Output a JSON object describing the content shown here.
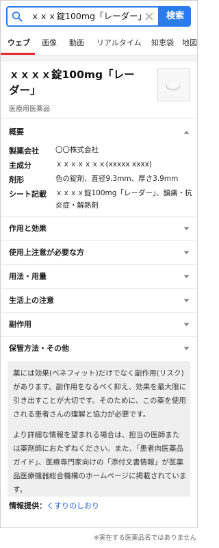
{
  "search": {
    "query": "ｘｘｘ錠100mg「レーダー」",
    "button_label": "検索"
  },
  "tabs": [
    {
      "label": "ウェブ",
      "active": true
    },
    {
      "label": "画像"
    },
    {
      "label": "動画"
    },
    {
      "label": "リアルタイム"
    },
    {
      "label": "知恵袋"
    },
    {
      "label": "地図"
    }
  ],
  "medicine": {
    "title": "ｘｘｘｘ錠100mg「レーダー」",
    "category": "医療用医薬品"
  },
  "overview": {
    "header": "概要",
    "rows": [
      {
        "key": "製薬会社",
        "value": "〇〇株式会社"
      },
      {
        "key": "主成分",
        "value": "ｘｘｘｘｘｘｘ(xxxxx xxxx)"
      },
      {
        "key": "剤形",
        "value": "色の錠剤、直径9.3mm、厚さ3.9mm"
      },
      {
        "key": "シート記載",
        "value": "ｘｘｘｘ錠100mg「レーダー」、鎮痛・抗炎症・解熱剤"
      }
    ]
  },
  "sections": [
    {
      "label": "作用と効果"
    },
    {
      "label": "使用上注意が必要な方"
    },
    {
      "label": "用法・用量"
    },
    {
      "label": "生活上の注意"
    },
    {
      "label": "副作用"
    },
    {
      "label": "保管方法・その他"
    }
  ],
  "info": {
    "paragraph1": "薬には効果(ベネフィット)だけでなく副作用(リスク)があります。副作用をなるべく抑え、効果を最大限に引き出すことが大切です。そのために、この薬を使用される患者さんの理解と協力が必要です。",
    "paragraph2": "より詳細な情報を望まれる場合は、担当の医師または薬剤師におたずねください。また、「患者向医薬品ガイド」、医療専門家向けの「添付文書情報」が医薬品医療機器総合機構のホームページに掲載されています。"
  },
  "source": {
    "label": "情報提供：",
    "link": "くすりのしおり"
  },
  "footer_note": "※実在する医薬品名ではありません",
  "colors": {
    "accent": "#2a7de8",
    "tab_underline": "#e8262f",
    "link": "#1a5fc7"
  }
}
